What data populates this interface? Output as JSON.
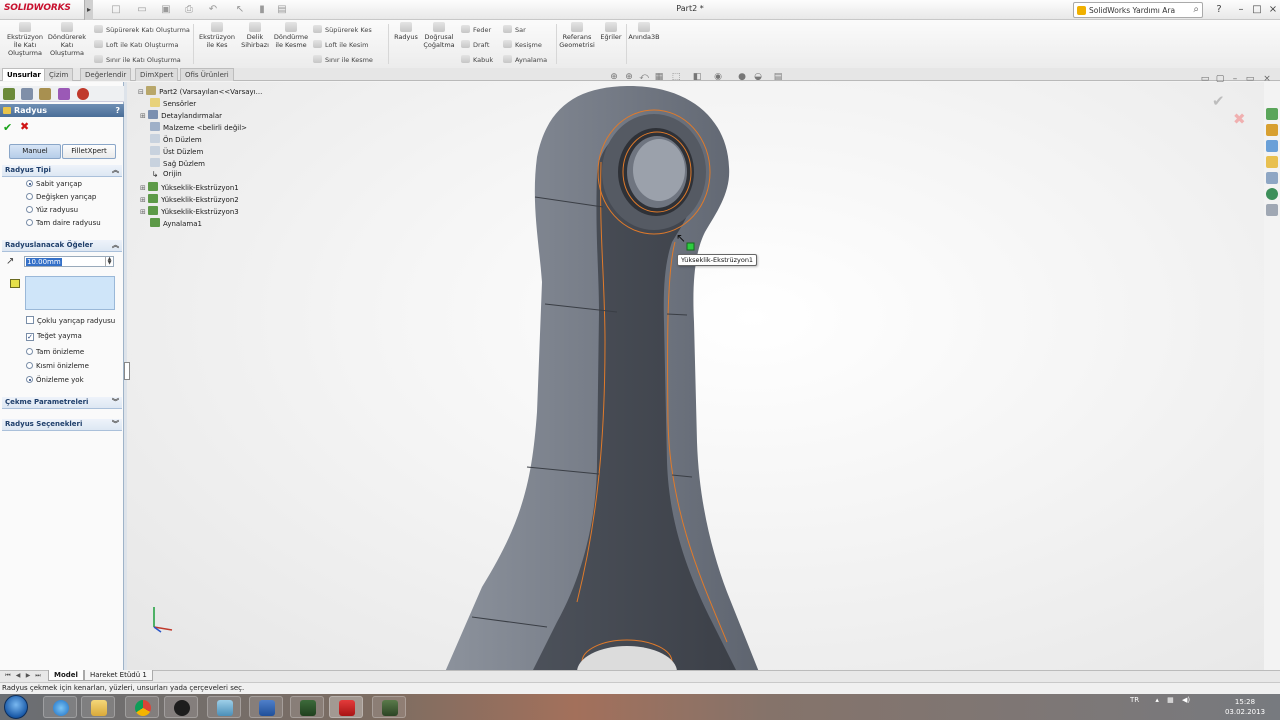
{
  "window": {
    "app_logo": "SOLIDWORKS",
    "title": "Part2 *",
    "help_search_label": "SolidWorks Yardımı Ara",
    "controls": [
      "?",
      "–",
      "□",
      "×"
    ]
  },
  "command_manager": {
    "big_buttons": [
      {
        "label": "Ekstrüzyon İle Katı Oluşturma",
        "icon": "extrude-boss-icon"
      },
      {
        "label": "Döndürerek Katı Oluşturma",
        "icon": "revolve-boss-icon"
      },
      {
        "label": "Ekstrüzyon ile Kes",
        "icon": "extrude-cut-icon"
      },
      {
        "label": "Delik Sihirbazı",
        "icon": "hole-wizard-icon"
      },
      {
        "label": "Döndürme ile Kesme",
        "icon": "revolve-cut-icon"
      },
      {
        "label": "Radyus",
        "icon": "fillet-icon"
      },
      {
        "label": "Doğrusal Çoğaltma",
        "icon": "linear-pattern-icon"
      },
      {
        "label": "Referans Geometrisi",
        "icon": "reference-geometry-icon"
      },
      {
        "label": "Eğriler",
        "icon": "curves-icon"
      },
      {
        "label": "Anında3B",
        "icon": "instant3d-icon"
      }
    ],
    "small_buttons_col1": [
      "Süpürerek Katı Oluşturma",
      "Loft ile Katı Oluşturma",
      "Sınır ile Katı Oluşturma"
    ],
    "small_buttons_col2": [
      "Süpürerek Kes",
      "Loft ile Kesim",
      "Sınır ile Kesme"
    ],
    "small_buttons_col3": [
      "Feder",
      "Draft",
      "Kabuk"
    ],
    "small_buttons_col4": [
      "Sar",
      "Kesişme",
      "Aynalama"
    ]
  },
  "tabs": [
    "Unsurlar",
    "Çizim",
    "Değerlendir",
    "DimXpert",
    "Ofis Ürünleri"
  ],
  "active_tab": "Unsurlar",
  "property_manager": {
    "title": "Radyus",
    "help": "?",
    "ok_icon": "check-icon",
    "cancel_icon": "close-icon",
    "mode_tabs": [
      "Manuel",
      "FilletXpert"
    ],
    "groups": {
      "radius_type": {
        "label": "Radyus Tipi",
        "options": [
          "Sabit yarıçap",
          "Değişken yarıçap",
          "Yüz radyusu",
          "Tam daire radyusu"
        ],
        "selected": "Sabit yarıçap"
      },
      "items_to_fillet": {
        "label": "Radyuslanacak Öğeler",
        "radius_value": "10.00mm",
        "checkboxes": [
          {
            "label": "Çoklu yarıçap radyusu",
            "checked": false
          },
          {
            "label": "Teğet yayma",
            "checked": true
          }
        ],
        "preview_options": [
          "Tam önizleme",
          "Kısmi önizleme",
          "Önizleme yok"
        ],
        "preview_selected": "Önizleme yok"
      },
      "setback": {
        "label": "Çekme Parametreleri"
      },
      "fillet_options": {
        "label": "Radyus Seçenekleri"
      }
    }
  },
  "feature_tree": {
    "root": "Part2  (Varsayılan<<Varsayı...",
    "items": [
      {
        "label": "Sensörler",
        "expand": ""
      },
      {
        "label": "Detaylandırmalar",
        "expand": "+"
      },
      {
        "label": "Malzeme <belirli değil>",
        "expand": ""
      },
      {
        "label": "Ön Düzlem",
        "expand": ""
      },
      {
        "label": "Üst Düzlem",
        "expand": ""
      },
      {
        "label": "Sağ Düzlem",
        "expand": ""
      },
      {
        "label": "Orijin",
        "expand": ""
      },
      {
        "label": "Yükseklik-Ekstrüzyon1",
        "expand": "+"
      },
      {
        "label": "Yükseklik-Ekstrüzyon2",
        "expand": "+"
      },
      {
        "label": "Yükseklik-Ekstrüzyon3",
        "expand": "+"
      },
      {
        "label": "Aynalama1",
        "expand": ""
      }
    ]
  },
  "viewport": {
    "tooltip": "Yükseklik-Ekstrüzyon1",
    "model_color": "#6e7480",
    "selection_color": "#e07a2a"
  },
  "bottom_tabs": [
    "Model",
    "Hareket Etüdü 1"
  ],
  "status_text": "Radyus çekmek için kenarları, yüzleri, unsurları yada çerçeveleri seç.",
  "taskbar": {
    "tray_lang": "TR",
    "time": "15:28",
    "date": "03.02.2013"
  }
}
